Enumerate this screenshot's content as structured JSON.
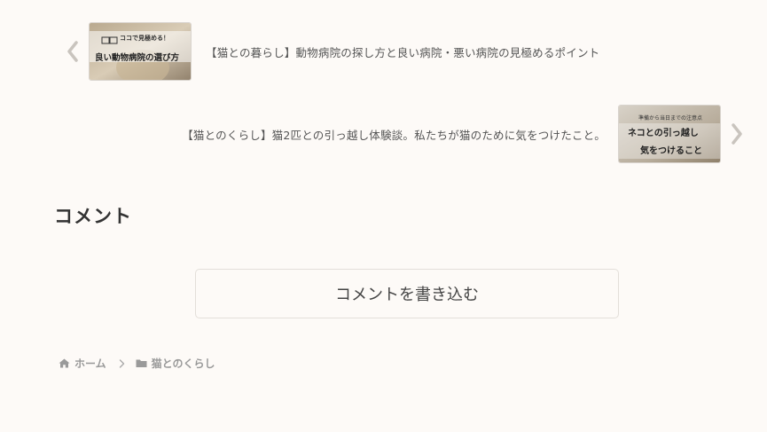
{
  "post_nav": {
    "prev": {
      "title": "【猫との暮らし】動物病院の探し方と良い病院・悪い病院の見極めるポイント",
      "thumb_text_top": "ココで見極める！",
      "thumb_text_main": "良い動物病院の選び方",
      "chevron_icon": "chevron-left-icon"
    },
    "next": {
      "title": "【猫とのくらし】猫2匹との引っ越し体験談。私たちが猫のために気をつけたこと。",
      "thumb_text_top": "準備から当日までの注意点",
      "thumb_text_line1": "ネコとの引っ越し",
      "thumb_text_line2": "気をつけること",
      "chevron_icon": "chevron-right-icon"
    }
  },
  "comments": {
    "heading": "コメント",
    "write_button": "コメントを書き込む"
  },
  "breadcrumb": {
    "home_label": "ホーム",
    "home_icon": "home-icon",
    "separator_icon": "chevron-right-icon",
    "category_label": "猫とのくらし",
    "category_icon": "folder-icon"
  },
  "colors": {
    "background": "#fdfaf7",
    "text": "#555555",
    "muted": "#999999"
  }
}
